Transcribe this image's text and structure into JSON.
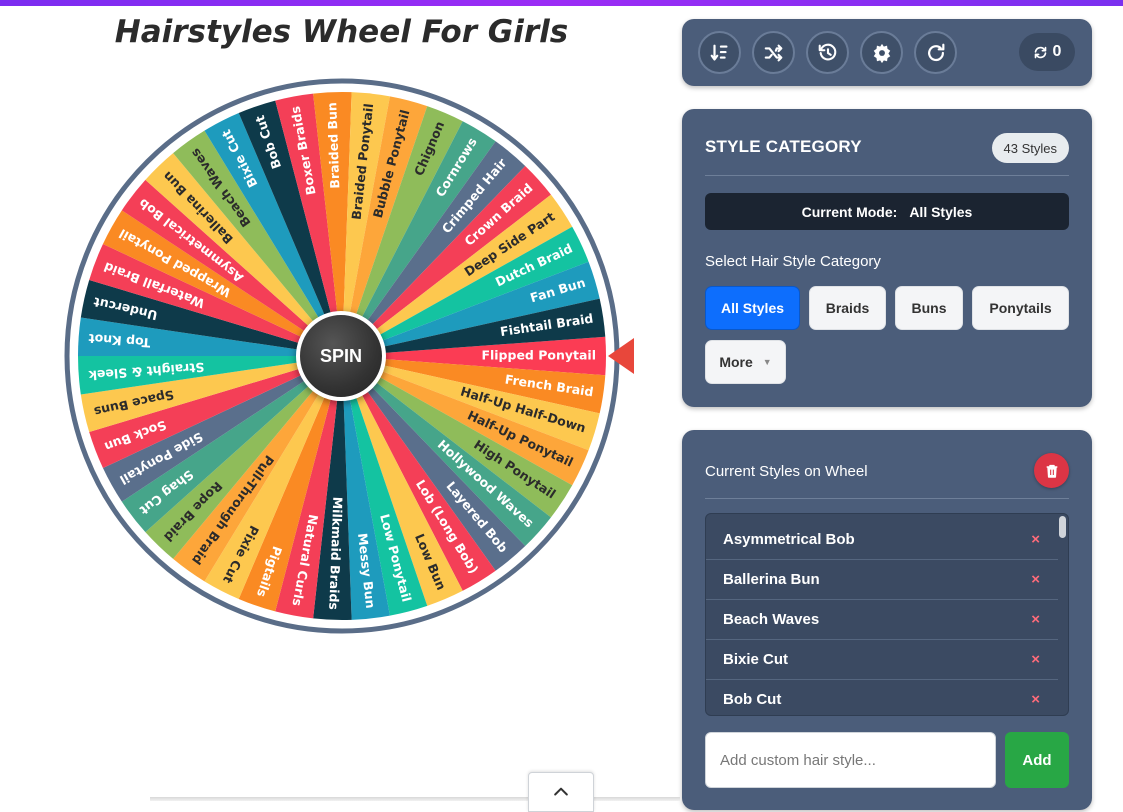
{
  "page_title": "Hairstyles Wheel For Girls",
  "spin_label": "SPIN",
  "wheel": {
    "segments": [
      {
        "label": "Flipped Ponytail",
        "color": "#fb3c54"
      },
      {
        "label": "French Braid",
        "color": "#fa8a23"
      },
      {
        "label": "Half-Up Half-Down",
        "color": "#fdc84f"
      },
      {
        "label": "Half-Up Ponytail",
        "color": "#fda63a"
      },
      {
        "label": "High Ponytail",
        "color": "#8fbc5a"
      },
      {
        "label": "Hollywood Waves",
        "color": "#46a58a"
      },
      {
        "label": "Layered Bob",
        "color": "#5a6f8c"
      },
      {
        "label": "Lob (Long Bob)",
        "color": "#f43f57"
      },
      {
        "label": "Low Bun",
        "color": "#fdc84f"
      },
      {
        "label": "Low Ponytail",
        "color": "#14c3a1"
      },
      {
        "label": "Messy Bun",
        "color": "#1e9bbd"
      },
      {
        "label": "Milkmaid Braids",
        "color": "#0e3a4a"
      },
      {
        "label": "Natural Curls",
        "color": "#f43f57"
      },
      {
        "label": "Pigtails",
        "color": "#fa8a23"
      },
      {
        "label": "Pixie Cut",
        "color": "#fdc84f"
      },
      {
        "label": "Pull-Through Braid",
        "color": "#fda63a"
      },
      {
        "label": "Rope Braid",
        "color": "#8fbc5a"
      },
      {
        "label": "Shag Cut",
        "color": "#46a58a"
      },
      {
        "label": "Side Ponytail",
        "color": "#5a6f8c"
      },
      {
        "label": "Sock Bun",
        "color": "#f43f57"
      },
      {
        "label": "Space Buns",
        "color": "#fdc84f"
      },
      {
        "label": "Straight & Sleek",
        "color": "#14c3a1"
      },
      {
        "label": "Top Knot",
        "color": "#1e9bbd"
      },
      {
        "label": "Undercut",
        "color": "#0e3a4a"
      },
      {
        "label": "Waterfall Braid",
        "color": "#f43f57"
      },
      {
        "label": "Wrapped Ponytail",
        "color": "#fa8a23"
      },
      {
        "label": "Asymmetrical Bob",
        "color": "#f43f57"
      },
      {
        "label": "Ballerina Bun",
        "color": "#fdc84f"
      },
      {
        "label": "Beach Waves",
        "color": "#8fbc5a"
      },
      {
        "label": "Bixie Cut",
        "color": "#1e9bbd"
      },
      {
        "label": "Bob Cut",
        "color": "#0e3a4a"
      },
      {
        "label": "Boxer Braids",
        "color": "#f43f57"
      },
      {
        "label": "Braided Bun",
        "color": "#fa8a23"
      },
      {
        "label": "Braided Ponytail",
        "color": "#fdc84f"
      },
      {
        "label": "Bubble Ponytail",
        "color": "#fda63a"
      },
      {
        "label": "Chignon",
        "color": "#8fbc5a"
      },
      {
        "label": "Cornrows",
        "color": "#46a58a"
      },
      {
        "label": "Crimped Hair",
        "color": "#5a6f8c"
      },
      {
        "label": "Crown Braid",
        "color": "#f43f57"
      },
      {
        "label": "Deep Side Part",
        "color": "#fdc84f"
      },
      {
        "label": "Dutch Braid",
        "color": "#14c3a1"
      },
      {
        "label": "Fan Bun",
        "color": "#1e9bbd"
      },
      {
        "label": "Fishtail Braid",
        "color": "#0e3a4a"
      }
    ]
  },
  "toolbar": {
    "buttons": [
      {
        "name": "sort-icon"
      },
      {
        "name": "shuffle-icon"
      },
      {
        "name": "history-icon"
      },
      {
        "name": "gear-icon"
      },
      {
        "name": "redo-icon"
      }
    ],
    "spin_count": "0"
  },
  "category_panel": {
    "title": "STYLE CATEGORY",
    "count_badge": "43 Styles",
    "mode_label": "Current Mode:",
    "mode_value": "All Styles",
    "select_label": "Select Hair Style Category",
    "buttons": [
      "All Styles",
      "Braids",
      "Buns",
      "Ponytails",
      "More"
    ],
    "active": "All Styles"
  },
  "current_panel": {
    "title": "Current Styles on Wheel",
    "items": [
      "Asymmetrical Bob",
      "Ballerina Bun",
      "Beach Waves",
      "Bixie Cut",
      "Bob Cut"
    ],
    "remove_glyph": "×",
    "input_placeholder": "Add custom hair style...",
    "add_label": "Add"
  }
}
